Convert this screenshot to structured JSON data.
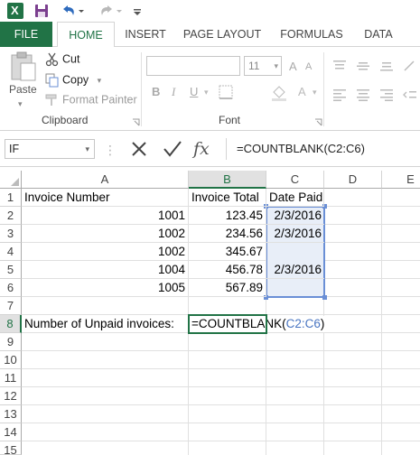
{
  "quick_access": {
    "app_icon": "excel-icon",
    "save_icon": "save-icon",
    "undo_icon": "undo-icon",
    "redo_icon": "redo-icon",
    "customize_icon": "customize-toolbar-icon"
  },
  "tabs": [
    {
      "label": "FILE",
      "active": false
    },
    {
      "label": "HOME",
      "active": true
    },
    {
      "label": "INSERT",
      "active": false
    },
    {
      "label": "PAGE LAYOUT",
      "active": false
    },
    {
      "label": "FORMULAS",
      "active": false
    },
    {
      "label": "DATA",
      "active": false
    }
  ],
  "ribbon": {
    "clipboard": {
      "paste_label": "Paste",
      "cut_label": "Cut",
      "copy_label": "Copy",
      "format_painter_label": "Format Painter",
      "group_label": "Clipboard"
    },
    "font": {
      "font_name": "",
      "font_size": "11",
      "bold": "B",
      "italic": "I",
      "underline": "U",
      "group_label": "Font"
    }
  },
  "formula_bar": {
    "name_box": "IF",
    "formula": "=COUNTBLANK(C2:C6)"
  },
  "columns": [
    "A",
    "B",
    "C",
    "D",
    "E"
  ],
  "rows": [
    "1",
    "2",
    "3",
    "4",
    "5",
    "6",
    "7",
    "8",
    "9",
    "10",
    "11",
    "12",
    "13",
    "14",
    "15"
  ],
  "cells": {
    "A1": "Invoice Number",
    "B1": "Invoice Total",
    "C1": "Date Paid",
    "A2": "1001",
    "B2": "123.45",
    "C2": "2/3/2016",
    "A3": "1002",
    "B3": "234.56",
    "C3": "2/3/2016",
    "A4": "1002",
    "B4": "345.67",
    "A5": "1004",
    "B5": "456.78",
    "C5": "2/3/2016",
    "A6": "1005",
    "B6": "567.89",
    "A8": "Number of Unpaid invoices:"
  },
  "editing_cell": {
    "address": "B8",
    "prefix": "=COUNTBLANK(",
    "reference": "C2:C6",
    "suffix": ")"
  },
  "colors": {
    "accent": "#217346",
    "reference_highlight": "#6a8fd6"
  }
}
